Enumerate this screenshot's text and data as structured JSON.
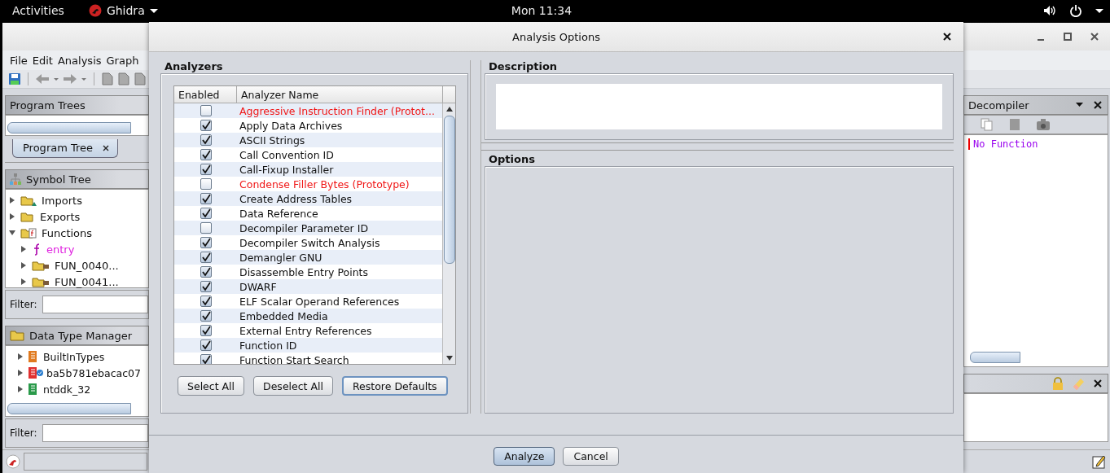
{
  "top_bar": {
    "activities": "Activities",
    "app_menu": "Ghidra",
    "clock": "Mon 11:34"
  },
  "main_window": {
    "menu": [
      "File",
      "Edit",
      "Analysis",
      "Graph"
    ],
    "program_trees": {
      "title": "Program Trees",
      "tab": {
        "label": "Program Tree",
        "selected": true
      }
    },
    "symbol_tree": {
      "title": "Symbol Tree",
      "filter_label": "Filter:",
      "nodes": [
        {
          "label": "Imports",
          "kind": "imports",
          "expanded": false
        },
        {
          "label": "Exports",
          "kind": "folder",
          "expanded": false
        },
        {
          "label": "Functions",
          "kind": "functions",
          "expanded": true,
          "children": [
            {
              "label": "entry",
              "kind": "function",
              "expanded": false
            },
            {
              "label": "FUN_0040...",
              "kind": "namespace",
              "expanded": false
            },
            {
              "label": "FUN_0041...",
              "kind": "namespace",
              "expanded": false
            }
          ]
        }
      ]
    },
    "data_type_manager": {
      "title": "Data Type Manager",
      "filter_label": "Filter:",
      "archives": [
        {
          "label": "BuiltInTypes",
          "kind": "builtin",
          "expanded": false
        },
        {
          "label": "ba5b781ebacac07",
          "kind": "program",
          "expanded": false
        },
        {
          "label": "ntddk_32",
          "kind": "archive",
          "expanded": false
        }
      ]
    },
    "decompiler": {
      "title": "Decompiler",
      "message": "No Function"
    }
  },
  "dialog": {
    "title": "Analysis Options",
    "analyzers": {
      "title": "Analyzers",
      "columns": [
        "Enabled",
        "Analyzer Name"
      ],
      "rows": [
        {
          "name": "Aggressive Instruction Finder (Protot...",
          "enabled": false,
          "prototype": true
        },
        {
          "name": "Apply Data Archives",
          "enabled": true,
          "prototype": false
        },
        {
          "name": "ASCII Strings",
          "enabled": true,
          "prototype": false
        },
        {
          "name": "Call Convention ID",
          "enabled": true,
          "prototype": false
        },
        {
          "name": "Call-Fixup Installer",
          "enabled": true,
          "prototype": false
        },
        {
          "name": "Condense Filler Bytes (Prototype)",
          "enabled": false,
          "prototype": true
        },
        {
          "name": "Create Address Tables",
          "enabled": true,
          "prototype": false
        },
        {
          "name": "Data Reference",
          "enabled": true,
          "prototype": false
        },
        {
          "name": "Decompiler Parameter ID",
          "enabled": false,
          "prototype": false
        },
        {
          "name": "Decompiler Switch Analysis",
          "enabled": true,
          "prototype": false
        },
        {
          "name": "Demangler GNU",
          "enabled": true,
          "prototype": false
        },
        {
          "name": "Disassemble Entry Points",
          "enabled": true,
          "prototype": false
        },
        {
          "name": "DWARF",
          "enabled": true,
          "prototype": false
        },
        {
          "name": "ELF Scalar Operand References",
          "enabled": true,
          "prototype": false
        },
        {
          "name": "Embedded Media",
          "enabled": true,
          "prototype": false
        },
        {
          "name": "External Entry References",
          "enabled": true,
          "prototype": false
        },
        {
          "name": "Function ID",
          "enabled": true,
          "prototype": false
        },
        {
          "name": "Function Start Search",
          "enabled": true,
          "prototype": false
        }
      ]
    },
    "list_buttons": [
      {
        "label": "Select All",
        "focused": false
      },
      {
        "label": "Deselect All",
        "focused": false
      },
      {
        "label": "Restore Defaults",
        "focused": true
      }
    ],
    "description": {
      "title": "Description"
    },
    "options": {
      "title": "Options"
    },
    "buttons": [
      {
        "label": "Analyze",
        "default": true
      },
      {
        "label": "Cancel",
        "default": false
      }
    ]
  }
}
